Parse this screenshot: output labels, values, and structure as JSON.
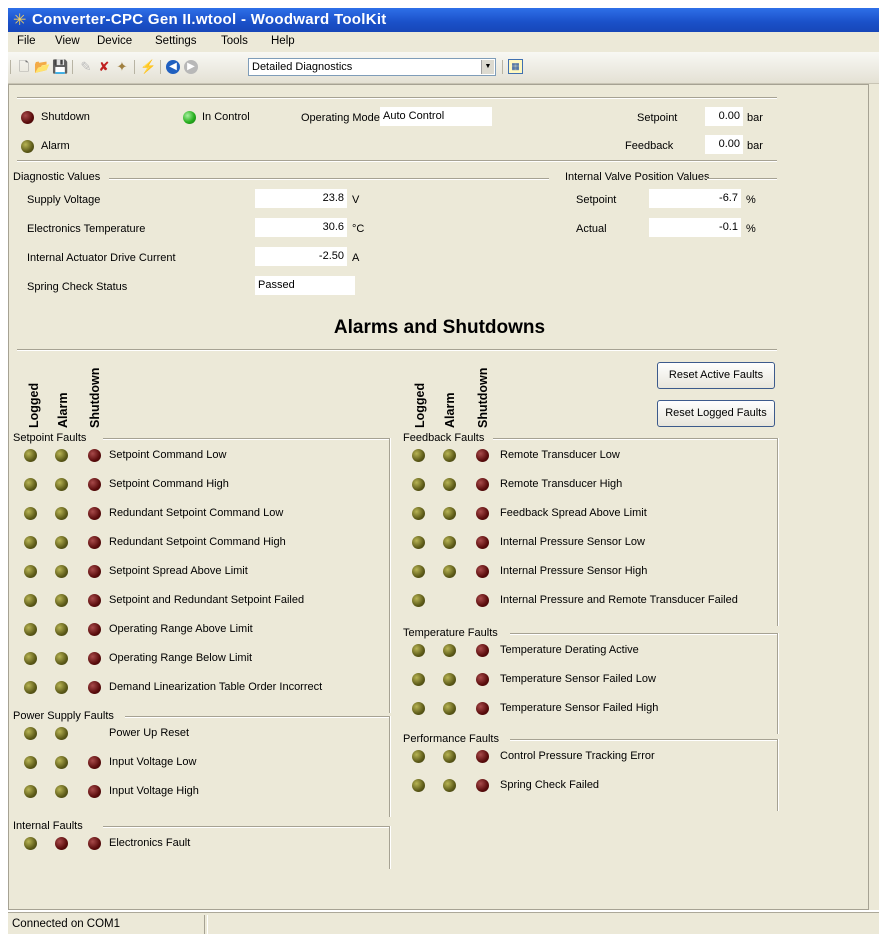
{
  "window": {
    "title": "Converter-CPC Gen II.wtool - Woodward ToolKit"
  },
  "menu": [
    "File",
    "View",
    "Device",
    "Settings",
    "Tools",
    "Help"
  ],
  "toolbar": {
    "view_selected": "Detailed Diagnostics"
  },
  "status": {
    "shutdown_label": "Shutdown",
    "alarm_label": "Alarm",
    "in_control_label": "In Control",
    "operating_mode_label": "Operating Mode",
    "operating_mode_value": "Auto Control",
    "setpoint_label": "Setpoint",
    "setpoint_value": "0.00",
    "setpoint_unit": "bar",
    "feedback_label": "Feedback",
    "feedback_value": "0.00",
    "feedback_unit": "bar"
  },
  "diagnostics": {
    "group_label": "Diagnostic Values",
    "rows": [
      {
        "label": "Supply Voltage",
        "value": "23.8",
        "unit": "V"
      },
      {
        "label": "Electronics Temperature",
        "value": "30.6",
        "unit": "°C"
      },
      {
        "label": "Internal Actuator Drive Current",
        "value": "-2.50",
        "unit": "A"
      },
      {
        "label": "Spring Check Status",
        "value": "Passed",
        "unit": ""
      }
    ]
  },
  "valve": {
    "group_label": "Internal Valve Position Values",
    "rows": [
      {
        "label": "Setpoint",
        "value": "-6.7",
        "unit": "%"
      },
      {
        "label": "Actual",
        "value": "-0.1",
        "unit": "%"
      }
    ]
  },
  "alarms": {
    "title": "Alarms and Shutdowns",
    "columns": [
      "Logged",
      "Alarm",
      "Shutdown"
    ],
    "reset_active_label": "Reset Active Faults",
    "reset_logged_label": "Reset Logged Faults",
    "left_groups": [
      {
        "name": "Setpoint Faults",
        "items": [
          {
            "label": "Setpoint Command Low",
            "leds": [
              "olive",
              "olive",
              "red"
            ]
          },
          {
            "label": "Setpoint Command High",
            "leds": [
              "olive",
              "olive",
              "red"
            ]
          },
          {
            "label": "Redundant Setpoint Command Low",
            "leds": [
              "olive",
              "olive",
              "red"
            ]
          },
          {
            "label": "Redundant Setpoint Command High",
            "leds": [
              "olive",
              "olive",
              "red"
            ]
          },
          {
            "label": "Setpoint Spread Above Limit",
            "leds": [
              "olive",
              "olive",
              "red"
            ]
          },
          {
            "label": "Setpoint and Redundant Setpoint Failed",
            "leds": [
              "olive",
              "olive",
              "red"
            ]
          },
          {
            "label": "Operating Range Above Limit",
            "leds": [
              "olive",
              "olive",
              "red"
            ]
          },
          {
            "label": "Operating Range Below Limit",
            "leds": [
              "olive",
              "olive",
              "red"
            ]
          },
          {
            "label": "Demand Linearization Table Order Incorrect",
            "leds": [
              "olive",
              "olive",
              "red"
            ]
          }
        ]
      },
      {
        "name": "Power Supply Faults",
        "items": [
          {
            "label": "Power Up Reset",
            "leds": [
              "olive",
              "olive",
              null
            ]
          },
          {
            "label": "Input Voltage Low",
            "leds": [
              "olive",
              "olive",
              "red"
            ]
          },
          {
            "label": "Input Voltage High",
            "leds": [
              "olive",
              "olive",
              "red"
            ]
          }
        ]
      },
      {
        "name": "Internal Faults",
        "items": [
          {
            "label": "Electronics Fault",
            "leds": [
              "olive",
              "red",
              "red"
            ]
          }
        ]
      }
    ],
    "right_groups": [
      {
        "name": "Feedback Faults",
        "items": [
          {
            "label": "Remote Transducer Low",
            "leds": [
              "olive",
              "olive",
              "red"
            ]
          },
          {
            "label": "Remote Transducer High",
            "leds": [
              "olive",
              "olive",
              "red"
            ]
          },
          {
            "label": "Feedback Spread Above Limit",
            "leds": [
              "olive",
              "olive",
              "red"
            ]
          },
          {
            "label": "Internal Pressure Sensor Low",
            "leds": [
              "olive",
              "olive",
              "red"
            ]
          },
          {
            "label": "Internal Pressure Sensor High",
            "leds": [
              "olive",
              "olive",
              "red"
            ]
          },
          {
            "label": "Internal Pressure and Remote Transducer Failed",
            "leds": [
              "olive",
              null,
              "red"
            ]
          }
        ]
      },
      {
        "name": "Temperature Faults",
        "items": [
          {
            "label": "Temperature Derating Active",
            "leds": [
              "olive",
              "olive",
              "red"
            ]
          },
          {
            "label": "Temperature Sensor Failed Low",
            "leds": [
              "olive",
              "olive",
              "red"
            ]
          },
          {
            "label": "Temperature Sensor Failed High",
            "leds": [
              "olive",
              "olive",
              "red"
            ]
          }
        ]
      },
      {
        "name": "Performance Faults",
        "items": [
          {
            "label": "Control Pressure Tracking Error",
            "leds": [
              "olive",
              "olive",
              "red"
            ]
          },
          {
            "label": "Spring Check Failed",
            "leds": [
              "olive",
              "olive",
              "red"
            ]
          }
        ]
      }
    ]
  },
  "statusbar": {
    "text": "Connected on COM1"
  }
}
